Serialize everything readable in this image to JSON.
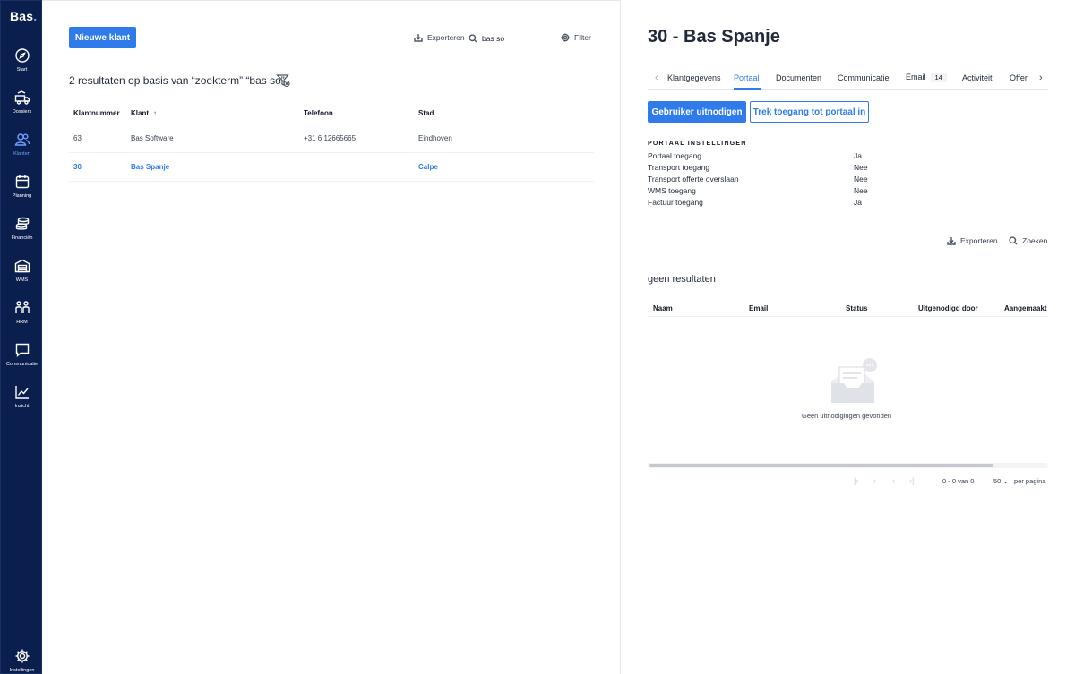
{
  "app": {
    "logo": "Bas",
    "logo_dot": "."
  },
  "sidebar": {
    "items": [
      {
        "label": "Start",
        "icon": "compass-icon"
      },
      {
        "label": "Dossiers",
        "icon": "truck-icon"
      },
      {
        "label": "Klanten",
        "icon": "users-icon",
        "active": true
      },
      {
        "label": "Planning",
        "icon": "calendar-icon"
      },
      {
        "label": "Financiën",
        "icon": "coins-icon"
      },
      {
        "label": "WMS",
        "icon": "warehouse-icon"
      },
      {
        "label": "HRM",
        "icon": "people-icon"
      },
      {
        "label": "Communicatie",
        "icon": "chat-icon"
      },
      {
        "label": "Inzicht",
        "icon": "chart-icon"
      }
    ],
    "settings_label": "Instellingen"
  },
  "list": {
    "new_button": "Nieuwe klant",
    "export_label": "Exporteren",
    "search_value": "bas so",
    "filter_label": "Filter",
    "results_title": "2 resultaten op basis van “zoekterm” “bas so”",
    "columns": [
      "Klantnummer",
      "Klant",
      "Telefoon",
      "Stad"
    ],
    "rows": [
      {
        "number": "63",
        "name": "Bas Software",
        "phone": "+31 6 12665665",
        "city": "Eindhoven",
        "selected": false
      },
      {
        "number": "30",
        "name": "Bas Spanje",
        "phone": "",
        "city": "Calpe",
        "selected": true
      }
    ]
  },
  "detail": {
    "title": "30 - Bas Spanje",
    "tabs": [
      "Klantgegevens",
      "Portaal",
      "Documenten",
      "Communicatie",
      "Email",
      "Activiteit",
      "Offer"
    ],
    "email_badge": "14",
    "active_tab": "Portaal",
    "invite_button": "Gebruiker uitnodigen",
    "revoke_button": "Trek toegang tot portaal in",
    "section_title": "PORTAAL INSTELLINGEN",
    "settings": [
      {
        "label": "Portaal toegang",
        "value": "Ja"
      },
      {
        "label": "Transport toegang",
        "value": "Nee"
      },
      {
        "label": "Transport offerte overslaan",
        "value": "Nee"
      },
      {
        "label": "WMS toegang",
        "value": "Nee"
      },
      {
        "label": "Factuur toegang",
        "value": "Ja"
      }
    ],
    "export_label": "Exporteren",
    "search_label": "Zoeken",
    "no_results": "geen resultaten",
    "invite_columns": [
      "Naam",
      "Email",
      "Status",
      "Uitgenodigd door",
      "Aangemaakt"
    ],
    "empty_text": "Geen uitnodigingen gevonden",
    "pagination": {
      "range": "0 - 0 van 0",
      "per_page": "50",
      "per_page_label": "per pagina"
    }
  },
  "colors": {
    "sidebar_bg": "#0b1f4f",
    "accent": "#2f7bea",
    "active_nav": "#6fa1ff"
  }
}
